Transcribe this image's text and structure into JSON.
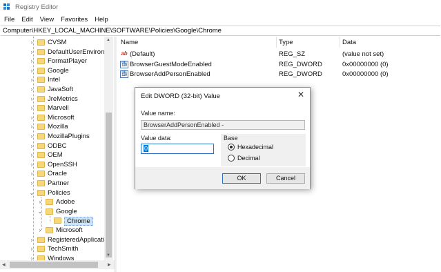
{
  "window": {
    "title": "Registry Editor"
  },
  "menu": [
    "File",
    "Edit",
    "View",
    "Favorites",
    "Help"
  ],
  "address": "Computer\\HKEY_LOCAL_MACHINE\\SOFTWARE\\Policies\\Google\\Chrome",
  "tree": {
    "items": [
      {
        "label": "CVSM",
        "level": 0
      },
      {
        "label": "DefaultUserEnvironn",
        "level": 0
      },
      {
        "label": "FormatPlayer",
        "level": 0
      },
      {
        "label": "Google",
        "level": 0
      },
      {
        "label": "Intel",
        "level": 0
      },
      {
        "label": "JavaSoft",
        "level": 0
      },
      {
        "label": "JreMetrics",
        "level": 0
      },
      {
        "label": "Marvell",
        "level": 0
      },
      {
        "label": "Microsoft",
        "level": 0
      },
      {
        "label": "Mozilla",
        "level": 0
      },
      {
        "label": "MozillaPlugins",
        "level": 0
      },
      {
        "label": "ODBC",
        "level": 0
      },
      {
        "label": "OEM",
        "level": 0
      },
      {
        "label": "OpenSSH",
        "level": 0
      },
      {
        "label": "Oracle",
        "level": 0
      },
      {
        "label": "Partner",
        "level": 0
      },
      {
        "label": "Policies",
        "level": 0,
        "expanded": true
      },
      {
        "label": "Adobe",
        "level": 1
      },
      {
        "label": "Google",
        "level": 1,
        "expanded": true
      },
      {
        "label": "Chrome",
        "level": 2,
        "selected": true
      },
      {
        "label": "Microsoft",
        "level": 1
      },
      {
        "label": "RegisteredApplicatic",
        "level": 0
      },
      {
        "label": "TechSmith",
        "level": 0
      },
      {
        "label": "Windows",
        "level": 0
      }
    ]
  },
  "list": {
    "columns": [
      "Name",
      "Type",
      "Data"
    ],
    "rows": [
      {
        "icon": "string-value-icon",
        "name": "(Default)",
        "type": "REG_SZ",
        "data": "(value not set)"
      },
      {
        "icon": "binary-value-icon",
        "name": "BrowserGuestModeEnabled",
        "type": "REG_DWORD",
        "data": "0x00000000 (0)"
      },
      {
        "icon": "binary-value-icon",
        "name": "BrowserAddPersonEnabled",
        "type": "REG_DWORD",
        "data": "0x00000000 (0)"
      }
    ]
  },
  "dialog": {
    "title": "Edit DWORD (32-bit) Value",
    "close": "✕",
    "value_name_label": "Value name:",
    "value_name": "BrowserAddPersonEnabled -",
    "value_data_label": "Value data:",
    "value_data": "0",
    "base_label": "Base",
    "hex_label": "Hexadecimal",
    "dec_label": "Decimal",
    "ok": "OK",
    "cancel": "Cancel"
  }
}
